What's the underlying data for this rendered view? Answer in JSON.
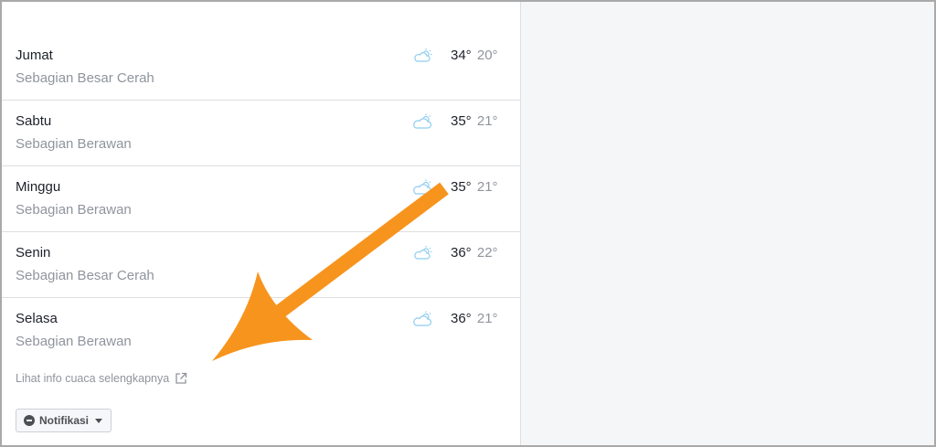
{
  "forecast": [
    {
      "day": "Jumat",
      "condition": "Sebagian Besar Cerah",
      "high": "34°",
      "low": "20°",
      "icon": "partly-sunny-icon"
    },
    {
      "day": "Sabtu",
      "condition": "Sebagian Berawan",
      "high": "35°",
      "low": "21°",
      "icon": "partly-cloudy-icon"
    },
    {
      "day": "Minggu",
      "condition": "Sebagian Berawan",
      "high": "35°",
      "low": "21°",
      "icon": "partly-cloudy-icon"
    },
    {
      "day": "Senin",
      "condition": "Sebagian Besar Cerah",
      "high": "36°",
      "low": "22°",
      "icon": "partly-sunny-icon"
    },
    {
      "day": "Selasa",
      "condition": "Sebagian Berawan",
      "high": "36°",
      "low": "21°",
      "icon": "partly-cloudy-icon"
    }
  ],
  "more_link": {
    "label": "Lihat info cuaca selengkapnya",
    "icon": "external-link-icon"
  },
  "notification_button": {
    "label": "Notifikasi",
    "icon": "minus-circle-icon",
    "caret_icon": "caret-down-icon"
  },
  "annotation": {
    "type": "orange-arrow",
    "color": "#f7941d"
  },
  "colors": {
    "primary_text": "#1d2129",
    "secondary_text": "#90949c",
    "icon": "#8ecdf0",
    "divider": "#dddfe2"
  }
}
